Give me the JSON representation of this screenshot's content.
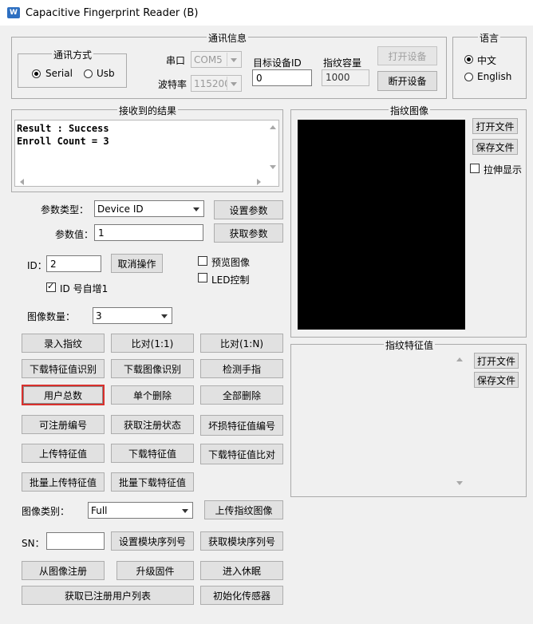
{
  "window": {
    "title": "Capacitive Fingerprint Reader (B)",
    "icon": "app-logo-icon"
  },
  "comm": {
    "legend": "通讯信息",
    "method_legend": "通讯方式",
    "serial_label": "Serial",
    "usb_label": "Usb",
    "selected": "Serial",
    "port_label": "串口",
    "port_value": "COM5",
    "baud_label": "波特率",
    "baud_value": "115200",
    "target_id_label": "目标设备ID",
    "target_id_value": "0",
    "capacity_label": "指纹容量",
    "capacity_value": "1000",
    "open_device": "打开设备",
    "close_device": "断开设备"
  },
  "language": {
    "legend": "语言",
    "chinese": "中文",
    "english": "English",
    "selected": "中文"
  },
  "result": {
    "legend": "接收到的结果",
    "line1": "Result : Success",
    "line2": "Enroll Count = 3"
  },
  "params": {
    "type_label": "参数类型：",
    "type_value": "Device ID",
    "value_label": "参数值：",
    "value_value": "1",
    "set_param": "设置参数",
    "get_param": "获取参数"
  },
  "id": {
    "label": "ID：",
    "value": "2",
    "cancel": "取消操作",
    "preview_image": "预览图像",
    "led_control": "LED控制",
    "auto_increment": "ID 号自增1",
    "auto_increment_checked": true,
    "preview_checked": false,
    "led_checked": false
  },
  "image_count": {
    "label": "图像数量：",
    "value": "3"
  },
  "buttons": {
    "enroll": "录入指纹",
    "match_1_1": "比对(1:1)",
    "match_1_n": "比对(1:N)",
    "download_feature_identify": "下载特征值识别",
    "download_image_identify": "下载图像识别",
    "detect_finger": "检测手指",
    "user_total": "用户总数",
    "delete_one": "单个删除",
    "delete_all": "全部删除",
    "enrollable_id": "可注册编号",
    "get_enroll_status": "获取注册状态",
    "damaged_feature_id": "坏损特征值编号",
    "upload_feature": "上传特征值",
    "download_feature": "下载特征值",
    "download_feature_compare": "下载特征值比对",
    "batch_upload_feature": "批量上传特征值",
    "batch_download_feature": "批量下载特征值",
    "upload_fingerprint_image": "上传指纹图像",
    "set_module_sn": "设置模块序列号",
    "get_module_sn": "获取模块序列号",
    "enroll_from_image": "从图像注册",
    "upgrade_firmware": "升级固件",
    "enter_sleep": "进入休眠",
    "get_enrolled_user_list": "获取已注册用户列表",
    "init_sensor": "初始化传感器"
  },
  "image_type": {
    "label": "图像类别：",
    "value": "Full"
  },
  "sn": {
    "label": "SN：",
    "value": ""
  },
  "fingerprint_image": {
    "legend": "指纹图像",
    "open_file": "打开文件",
    "save_file": "保存文件",
    "stretch_label": "拉伸显示",
    "stretch_checked": false,
    "canvas_color": "#000000"
  },
  "feature": {
    "legend": "指纹特征值",
    "open_file": "打开文件",
    "save_file": "保存文件"
  },
  "colors": {
    "focus_border": "#d9302c",
    "image_bg": "#000000"
  }
}
